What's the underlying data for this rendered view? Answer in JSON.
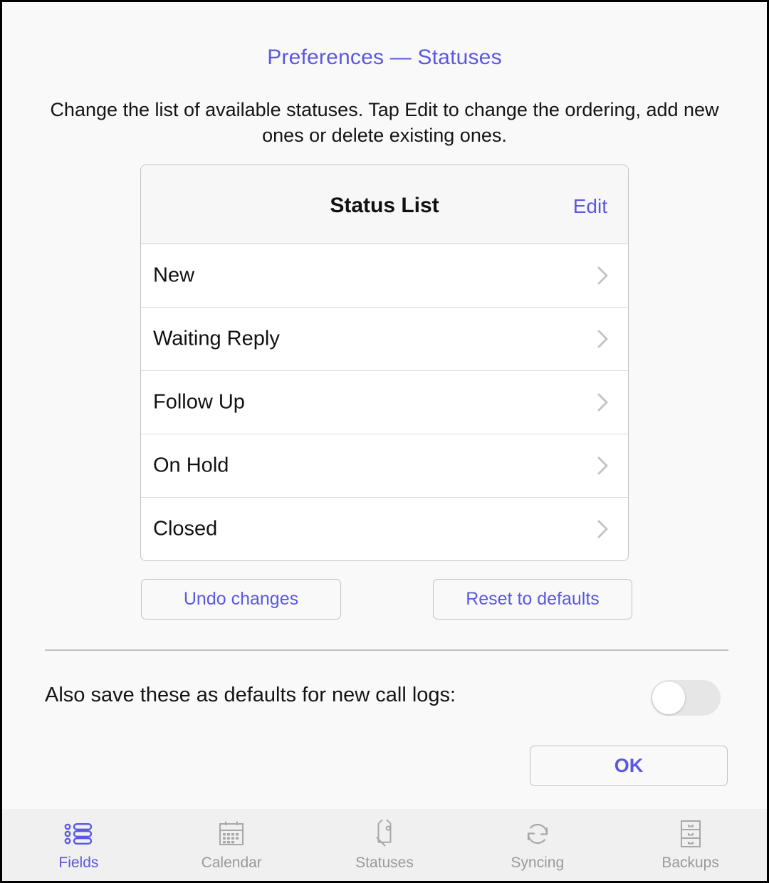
{
  "window": {
    "title": "Preferences — Statuses",
    "subtitle": "Change the list of available statuses.  Tap Edit to change the ordering, add new ones or delete existing ones."
  },
  "colors": {
    "accent": "#5b58e0",
    "page_background": "#f9f9f9",
    "card_background": "#ffffff",
    "list_header_background": "#f7f7f7",
    "tabbar_background": "#f0f0f0",
    "border": "#c2c2c2",
    "chevron": "#c4c4c4",
    "inactive_tab": "#9a9a9a"
  },
  "status_list": {
    "header_title": "Status List",
    "edit_label": "Edit",
    "rows": [
      {
        "label": "New",
        "accessory": "chevron-right-icon"
      },
      {
        "label": "Waiting Reply",
        "accessory": "chevron-right-icon"
      },
      {
        "label": "Follow Up",
        "accessory": "chevron-right-icon"
      },
      {
        "label": "On Hold",
        "accessory": "chevron-right-icon"
      },
      {
        "label": "Closed",
        "accessory": "chevron-right-icon"
      }
    ]
  },
  "actions": {
    "undo_label": "Undo changes",
    "reset_label": "Reset to defaults",
    "ok_label": "OK"
  },
  "defaults_row": {
    "label": "Also save these as defaults for new call logs:",
    "toggle_state": "off"
  },
  "tab_bar": {
    "active_index": 0,
    "tabs": [
      {
        "label": "Fields",
        "icon": "bullet-list-icon"
      },
      {
        "label": "Calendar",
        "icon": "calendar-icon"
      },
      {
        "label": "Statuses",
        "icon": "tag-icon"
      },
      {
        "label": "Syncing",
        "icon": "sync-arrows-icon"
      },
      {
        "label": "Backups",
        "icon": "file-cabinet-icon"
      }
    ]
  }
}
